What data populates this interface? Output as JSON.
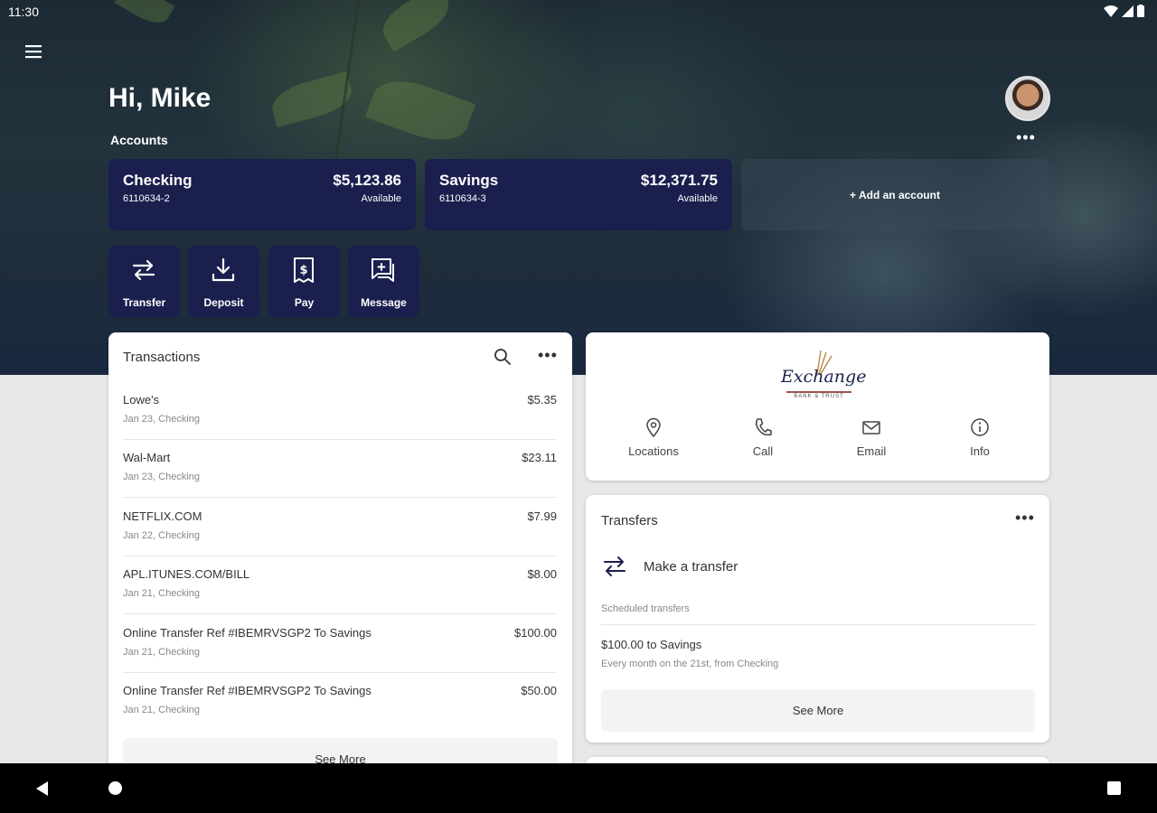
{
  "status": {
    "time": "11:30"
  },
  "header": {
    "greeting": "Hi, Mike",
    "accounts_label": "Accounts",
    "more": "•••"
  },
  "accounts": [
    {
      "name": "Checking",
      "number": "6110634-2",
      "balance": "$5,123.86",
      "balance_label": "Available"
    },
    {
      "name": "Savings",
      "number": "6110634-3",
      "balance": "$12,371.75",
      "balance_label": "Available"
    }
  ],
  "add_account": "+ Add an account",
  "actions": [
    {
      "label": "Transfer",
      "icon": "transfer-icon"
    },
    {
      "label": "Deposit",
      "icon": "deposit-icon"
    },
    {
      "label": "Pay",
      "icon": "pay-icon"
    },
    {
      "label": "Message",
      "icon": "message-icon"
    }
  ],
  "transactions": {
    "title": "Transactions",
    "more": "•••",
    "items": [
      {
        "name": "Lowe's",
        "sub": "Jan 23, Checking",
        "amount": "$5.35"
      },
      {
        "name": "Wal-Mart",
        "sub": "Jan 23, Checking",
        "amount": "$23.11"
      },
      {
        "name": "NETFLIX.COM",
        "sub": "Jan 22, Checking",
        "amount": "$7.99"
      },
      {
        "name": "APL.ITUNES.COM/BILL",
        "sub": "Jan 21, Checking",
        "amount": "$8.00"
      },
      {
        "name": "Online Transfer Ref #IBEMRVSGP2 To Savings",
        "sub": "Jan 21, Checking",
        "amount": "$100.00"
      },
      {
        "name": "Online Transfer Ref #IBEMRVSGP2 To Savings",
        "sub": "Jan 21, Checking",
        "amount": "$50.00"
      }
    ],
    "see_more": "See More"
  },
  "bank": {
    "logo_text": "Exchange",
    "logo_subtext": "BANK & TRUST",
    "links": [
      {
        "label": "Locations",
        "icon": "location-pin-icon"
      },
      {
        "label": "Call",
        "icon": "phone-icon"
      },
      {
        "label": "Email",
        "icon": "email-icon"
      },
      {
        "label": "Info",
        "icon": "info-icon"
      }
    ]
  },
  "transfers": {
    "title": "Transfers",
    "more": "•••",
    "make_transfer": "Make a transfer",
    "scheduled_label": "Scheduled transfers",
    "scheduled": [
      {
        "title": "$100.00 to Savings",
        "sub": "Every month on the 21st, from Checking"
      }
    ],
    "see_more": "See More"
  }
}
